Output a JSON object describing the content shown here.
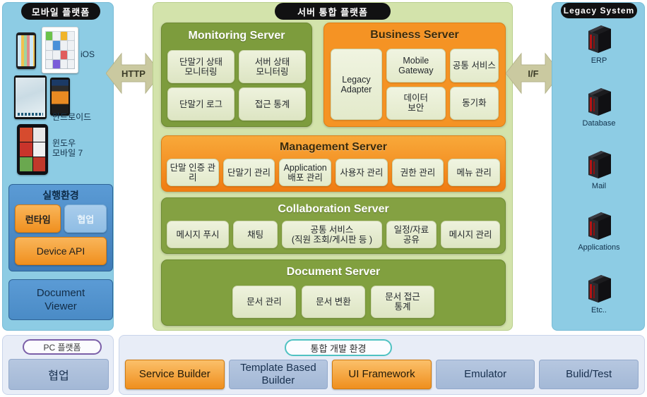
{
  "mobile_platform": {
    "badge": "모바일 플랫폼",
    "devices": [
      {
        "name": "iphone",
        "label": ""
      },
      {
        "name": "ipad",
        "label": "iOS"
      },
      {
        "name": "galaxy-tab",
        "label": ""
      },
      {
        "name": "android-phone",
        "label": "안드로이드"
      },
      {
        "name": "windows-phone",
        "label": "윈도우\n모바일 7"
      }
    ],
    "labels": {
      "ios": "iOS",
      "android": "안드로이드",
      "wp_line1": "윈도우",
      "wp_line2": "모바일 7"
    },
    "runtime": {
      "title": "실행환경",
      "chips": [
        {
          "label": "런타임",
          "color": "#f0901f"
        },
        {
          "label": "협업",
          "color": "#8fbde4"
        }
      ],
      "device_api": "Device API"
    },
    "document_viewer": {
      "line1": "Document",
      "line2": "Viewer"
    }
  },
  "connectors": {
    "http": "HTTP",
    "interface": "I/F",
    "arrow_color": "#cac9a0"
  },
  "server_platform": {
    "badge": "서버 통합 플랫폼",
    "panel_color": "#d3e3ab",
    "cards": [
      {
        "title": "Monitoring Server",
        "color": "#7d9c3d",
        "tiles": [
          "단말기 상태\n모니터링",
          "서버 상태\n모니터링",
          "단말기 로그",
          "접근 통계"
        ]
      },
      {
        "title": "Business Server",
        "color": "#f59324",
        "tiles": [
          "Mobile\nGateway",
          "공통 서비스",
          "Legacy\nAdapter",
          "데이터\n보안",
          "동기화"
        ]
      },
      {
        "title": "Management Server",
        "color": "#f59324",
        "tiles": [
          "단말 인증 관리",
          "단말기 관리",
          "Application\n배포 관리",
          "사용자 관리",
          "권한 관리",
          "메뉴 관리"
        ]
      },
      {
        "title": "Collaboration Server",
        "color": "#84a142",
        "tiles": [
          "메시지 푸시",
          "채팅",
          "공통 서비스\n(직원 조회/게시판 등 )",
          "일정/자료\n공유",
          "메시지 관리"
        ]
      },
      {
        "title": "Document Server",
        "color": "#81a03f",
        "tiles": [
          "문서 관리",
          "문서 변환",
          "문서 접근\n통계"
        ]
      }
    ]
  },
  "legacy_system": {
    "badge": "Legacy System",
    "panel_color": "#8dcce4",
    "items": [
      {
        "icon": "server-rack-icon",
        "label": "ERP"
      },
      {
        "icon": "server-rack-icon",
        "label": "Database"
      },
      {
        "icon": "server-rack-icon",
        "label": "Mail"
      },
      {
        "icon": "server-rack-icon",
        "label": "Applications"
      },
      {
        "icon": "server-rack-icon",
        "label": "Etc.."
      }
    ]
  },
  "pc_platform": {
    "badge": "PC 플랫폼",
    "badge_border": "#7b5fa8",
    "item": "협업"
  },
  "dev_environment": {
    "badge": "통합 개발 환경",
    "badge_border": "#4fc2c2",
    "chips": [
      {
        "label": "Service Builder",
        "color": "#ef8f1e",
        "highlight": true
      },
      {
        "label": "Template Based\nBuilder",
        "color": "#a3b8d6",
        "highlight": false
      },
      {
        "label": "UI Framework",
        "color": "#ef8f1e",
        "highlight": true
      },
      {
        "label": "Emulator",
        "color": "#a3b8d6",
        "highlight": false
      },
      {
        "label": "Bulid/Test",
        "color": "#a3b8d6",
        "highlight": false
      }
    ]
  }
}
